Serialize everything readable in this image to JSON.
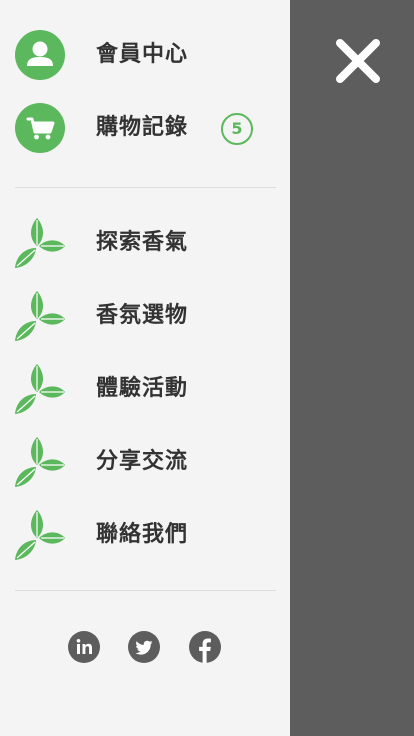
{
  "menu": {
    "account": {
      "label": "會員中心",
      "icon": "user-icon"
    },
    "orders": {
      "label": "購物記錄",
      "icon": "cart-icon",
      "badge": "5"
    },
    "nav_items": [
      {
        "label": "探索香氣",
        "icon": "leaf-icon"
      },
      {
        "label": "香氛選物",
        "icon": "leaf-icon"
      },
      {
        "label": "體驗活動",
        "icon": "leaf-icon"
      },
      {
        "label": "分享交流",
        "icon": "leaf-icon"
      },
      {
        "label": "聯絡我們",
        "icon": "leaf-icon"
      }
    ]
  },
  "social": [
    {
      "icon": "linkedin-icon"
    },
    {
      "icon": "twitter-icon"
    },
    {
      "icon": "facebook-icon"
    }
  ],
  "close": {
    "icon": "close-icon"
  },
  "colors": {
    "accent": "#5cb85c",
    "overlay": "#5d5d5d",
    "drawer_bg": "#f4f4f4",
    "text": "#333333"
  }
}
